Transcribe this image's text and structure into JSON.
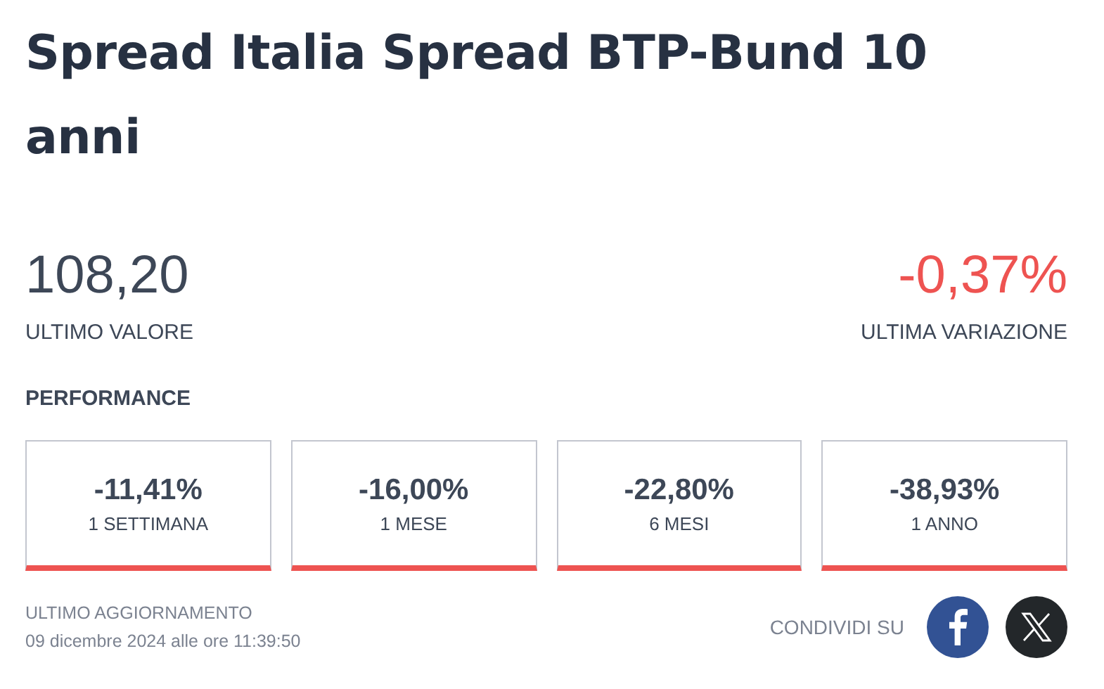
{
  "title": "Spread Italia Spread BTP-Bund 10 anni",
  "last_value": {
    "value": "108,20",
    "label": "ULTIMO VALORE"
  },
  "last_change": {
    "value": "-0,37%",
    "label": "ULTIMA VARIAZIONE",
    "color": "#ee5351"
  },
  "performance": {
    "heading": "PERFORMANCE",
    "cards": [
      {
        "value": "-11,41%",
        "period": "1 SETTIMANA",
        "color": "#ee5351"
      },
      {
        "value": "-16,00%",
        "period": "1 MESE",
        "color": "#ee5351"
      },
      {
        "value": "-22,80%",
        "period": "6 MESI",
        "color": "#ee5351"
      },
      {
        "value": "-38,93%",
        "period": "1 ANNO",
        "color": "#ee5351"
      }
    ]
  },
  "update": {
    "label": "ULTIMO AGGIORNAMENTO",
    "timestamp": "09 dicembre 2024 alle ore 11:39:50"
  },
  "share": {
    "label": "CONDIVIDI SU",
    "buttons": [
      {
        "kind": "facebook"
      },
      {
        "kind": "x"
      }
    ]
  }
}
